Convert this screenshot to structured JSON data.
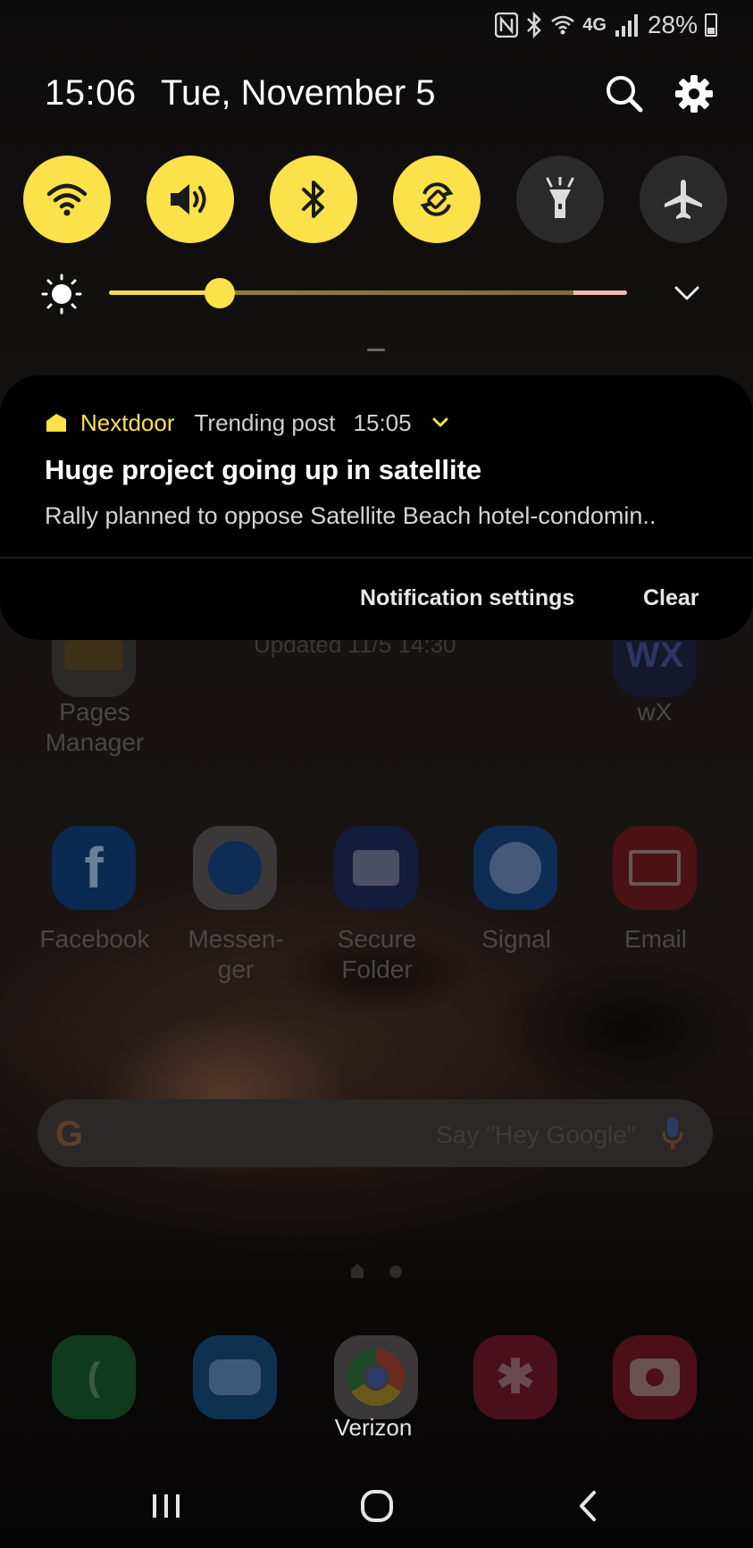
{
  "status_bar": {
    "battery": "28%",
    "network": "4G",
    "icons": [
      "nfc-icon",
      "bluetooth-icon",
      "wifi-icon",
      "signal-icon"
    ]
  },
  "header": {
    "time": "15:06",
    "date": "Tue, November 5"
  },
  "quick_toggles": [
    {
      "name": "wifi",
      "on": true
    },
    {
      "name": "sound",
      "on": true
    },
    {
      "name": "bluetooth",
      "on": true
    },
    {
      "name": "auto-rotate",
      "on": true
    },
    {
      "name": "flashlight",
      "on": false
    },
    {
      "name": "airplane-mode",
      "on": false
    }
  ],
  "brightness": {
    "level": 0.2
  },
  "notification": {
    "app_name": "Nextdoor",
    "category": "Trending post",
    "time": "15:05",
    "title": "Huge project going up in satellite",
    "body": "Rally planned to oppose Satellite Beach hotel-condomin..",
    "actions": {
      "settings": "Notification settings",
      "clear": "Clear"
    }
  },
  "home": {
    "widget_updated": "Updated 11/5 14:30",
    "widget_wx_text": "WX",
    "apps_row1": [
      {
        "label_line1": "Pages",
        "label_line2": "Manager"
      },
      {
        "label_line1": "wX",
        "label_line2": ""
      }
    ],
    "apps_row2": [
      {
        "label_line1": "Facebook",
        "label_line2": "",
        "color": "#0a2a52"
      },
      {
        "label_line1": "Messen-",
        "label_line2": "ger",
        "color": "#3a3838"
      },
      {
        "label_line1": "Secure",
        "label_line2": "Folder",
        "color": "#141c3c"
      },
      {
        "label_line1": "Signal",
        "label_line2": "",
        "color": "#0f2c55"
      },
      {
        "label_line1": "Email",
        "label_line2": "",
        "color": "#4a1212"
      }
    ],
    "search_placeholder": "Say \"Hey Google\"",
    "dock_label": "Verizon",
    "colors": {
      "accent_yellow": "#fbe14a",
      "phone": "#0f3a1c",
      "messages": "#0f3150",
      "chrome": "#3a3838",
      "bixby": "#4a0f1c",
      "camera": "#4a0f18"
    }
  }
}
